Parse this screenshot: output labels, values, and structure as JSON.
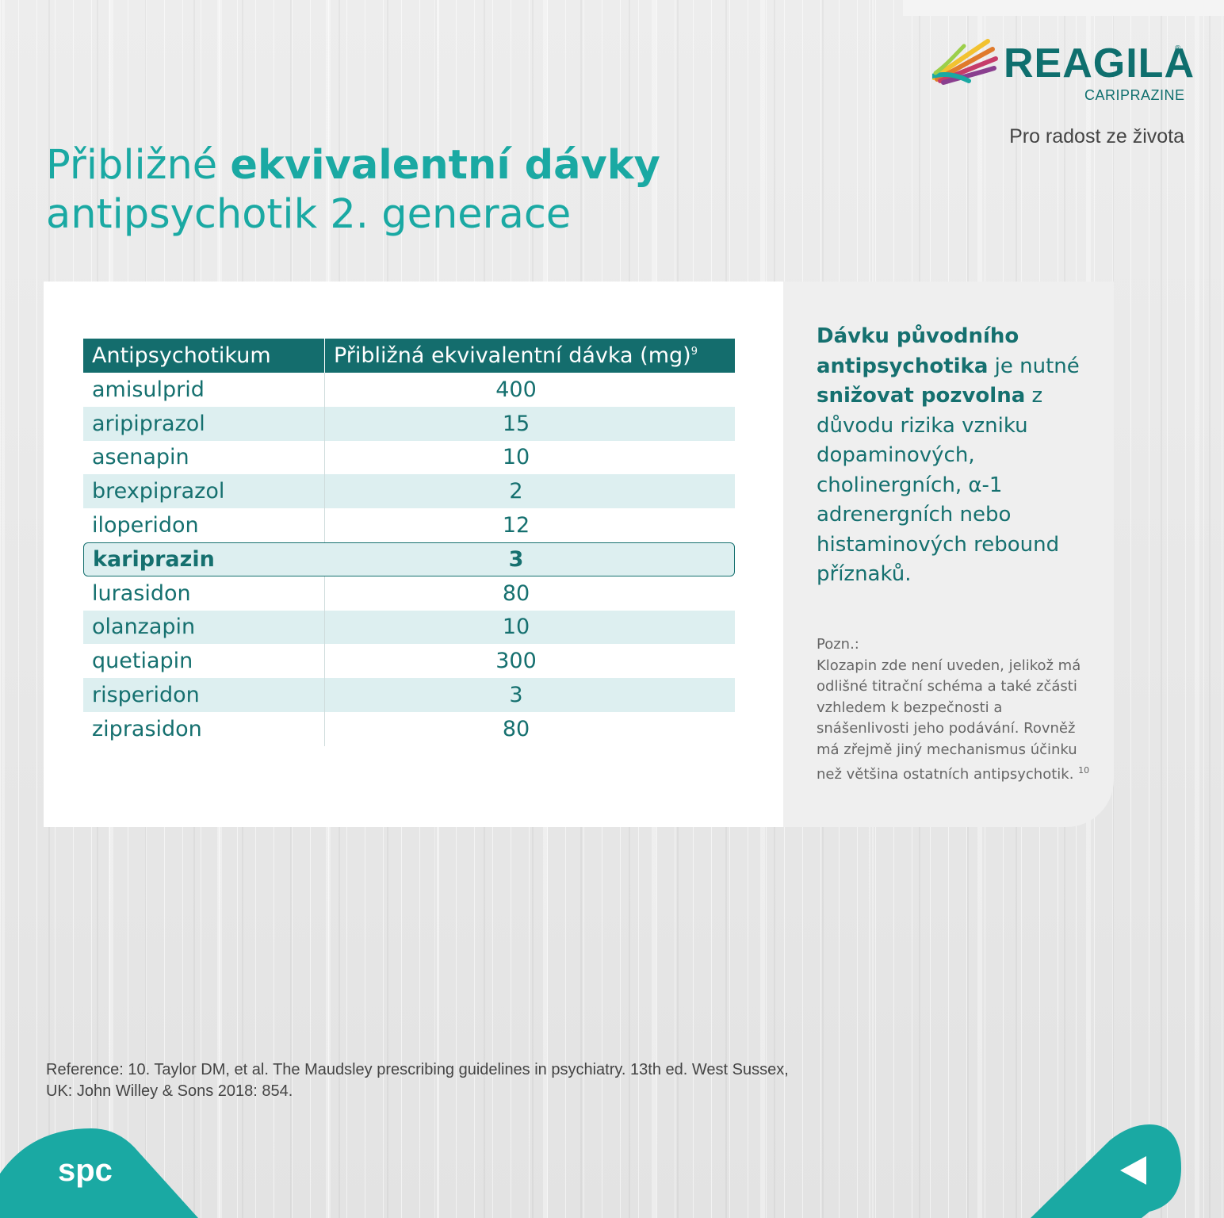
{
  "brand": {
    "name": "REAGILA",
    "registered": "®",
    "subtitle": "CARIPRAZINE",
    "tagline": "Pro radost ze života"
  },
  "title": {
    "line1_normal": "Přibližné ",
    "line1_bold": "ekvivalentní dávky",
    "line2": "antipsychotik 2. generace"
  },
  "table": {
    "headers": [
      "Antipsychotikum",
      "Přibližná ekvivalentní dávka (mg)"
    ],
    "header_ref": "9",
    "rows": [
      {
        "drug": "amisulprid",
        "dose": "400"
      },
      {
        "drug": "aripiprazol",
        "dose": "15"
      },
      {
        "drug": "asenapin",
        "dose": "10"
      },
      {
        "drug": "brexpiprazol",
        "dose": "2"
      },
      {
        "drug": "iloperidon",
        "dose": "12"
      },
      {
        "drug": "kariprazin",
        "dose": "3"
      },
      {
        "drug": "lurasidon",
        "dose": "80"
      },
      {
        "drug": "olanzapin",
        "dose": "10"
      },
      {
        "drug": "quetiapin",
        "dose": "300"
      },
      {
        "drug": "risperidon",
        "dose": "3"
      },
      {
        "drug": "ziprasidon",
        "dose": "80"
      }
    ]
  },
  "side": {
    "p1_bold": "Dávku původního antipsychotika",
    "p2": " je nutné ",
    "p3_bold": "snižovat pozvolna",
    "p4": " z důvodu rizika vzniku dopaminových, cholinergních, α-1 adrenergních nebo histaminových rebound příznaků."
  },
  "note": {
    "label": "Pozn.:",
    "text": "Klozapin zde není uveden, jelikož má odlišné titrační schéma a také zčásti vzhledem k bezpečnosti a snášenlivosti jeho podávání. Rovněž má zřejmě jiný mechanismus účinku než většina ostatních antipsychotik.",
    "ref": "10"
  },
  "reference": {
    "line1": "Reference: 10. Taylor DM, et al. The Maudsley prescribing guidelines in psychiatry. 13th ed. West Sussex,",
    "line2": "UK: John Willey & Sons 2018:  854."
  },
  "nav": {
    "spc_label": "spc",
    "back_icon": "back-arrow-icon"
  },
  "colors": {
    "teal_dark": "#146d6d",
    "teal": "#1aa9a3",
    "row_alt": "#ddeff0"
  }
}
